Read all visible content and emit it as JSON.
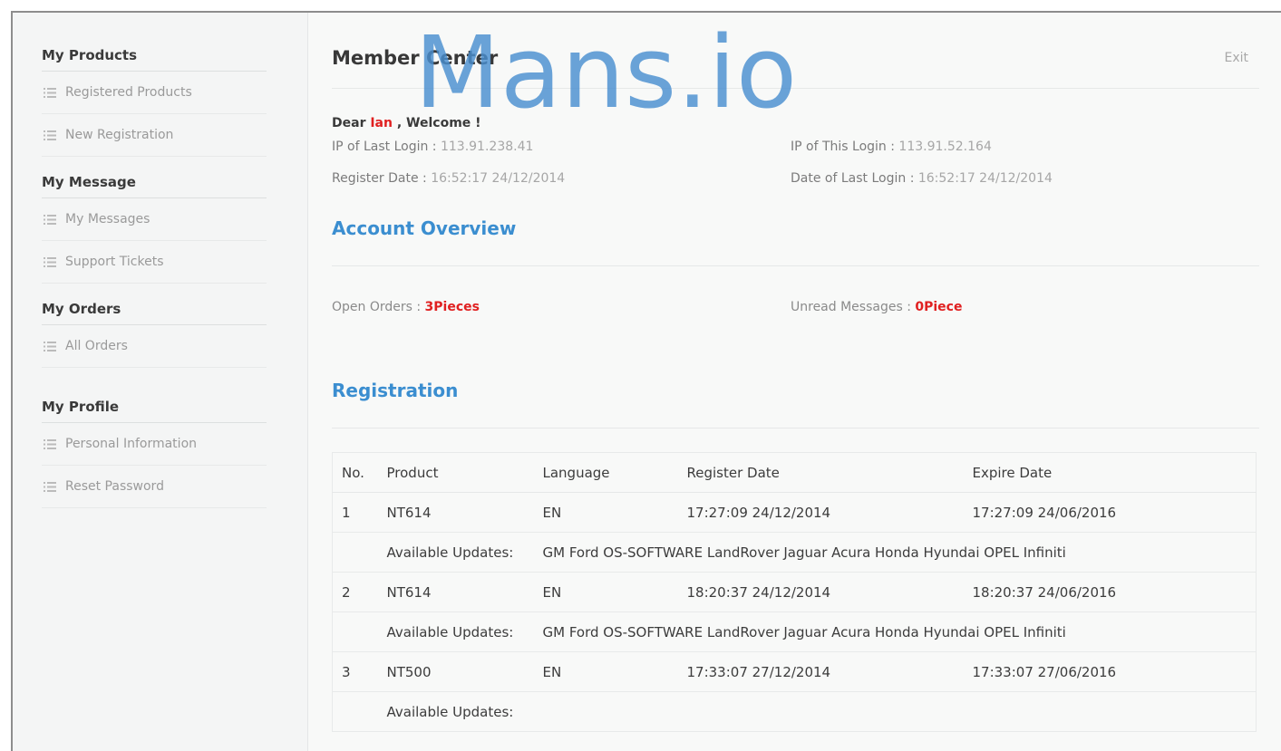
{
  "sidebar": {
    "groups": [
      {
        "title": "My Products",
        "items": [
          "Registered Products",
          "New Registration"
        ]
      },
      {
        "title": "My Message",
        "items": [
          "My Messages",
          "Support Tickets"
        ]
      },
      {
        "title": "My Orders",
        "items": [
          "All Orders"
        ]
      },
      {
        "title": "My Profile",
        "items": [
          "Personal Information",
          "Reset Password"
        ]
      }
    ]
  },
  "header": {
    "title": "Member Center",
    "exit_label": "Exit"
  },
  "welcome": {
    "prefix": "Dear",
    "user": "Ian",
    "suffix": ", Welcome !"
  },
  "login_info": {
    "last_ip_label": "IP of Last Login :",
    "last_ip": "113.91.238.41",
    "this_ip_label": "IP of This Login :",
    "this_ip": "113.91.52.164",
    "register_label": "Register Date :",
    "register_date": "16:52:17 24/12/2014",
    "last_login_label": "Date of Last Login :",
    "last_login_date": "16:52:17 24/12/2014"
  },
  "overview": {
    "title": "Account Overview",
    "open_orders_label": "Open Orders :",
    "open_orders_value": "3Pieces",
    "unread_label": "Unread Messages :",
    "unread_value": "0Piece"
  },
  "registration": {
    "title": "Registration",
    "columns": [
      "No.",
      "Product",
      "Language",
      "Register Date",
      "Expire Date"
    ],
    "updates_label": "Available Updates:",
    "rows": [
      {
        "no": "1",
        "product": "NT614",
        "language": "EN",
        "register": "17:27:09 24/12/2014",
        "expire": "17:27:09 24/06/2016",
        "updates": "GM Ford OS-SOFTWARE LandRover Jaguar Acura Honda Hyundai OPEL Infiniti"
      },
      {
        "no": "2",
        "product": "NT614",
        "language": "EN",
        "register": "18:20:37 24/12/2014",
        "expire": "18:20:37 24/06/2016",
        "updates": "GM Ford OS-SOFTWARE LandRover Jaguar Acura Honda Hyundai OPEL Infiniti"
      },
      {
        "no": "3",
        "product": "NT500",
        "language": "EN",
        "register": "17:33:07 27/12/2014",
        "expire": "17:33:07 27/06/2016",
        "updates": ""
      }
    ]
  },
  "watermark": "Mans.io",
  "colors": {
    "accent": "#3b8ed0",
    "highlight": "#e02020",
    "watermark": "#4a8fd0"
  },
  "icons": {
    "sidebar_item": "list-icon"
  }
}
